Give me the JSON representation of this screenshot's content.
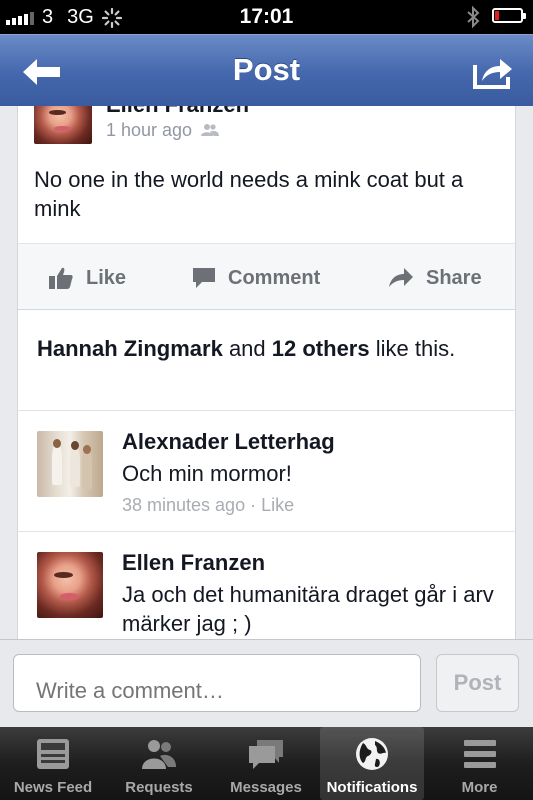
{
  "status_bar": {
    "carrier": "3",
    "network": "3G",
    "time": "17:01"
  },
  "nav": {
    "title": "Post"
  },
  "post": {
    "author": "Ellen Franzen",
    "time": "1 hour ago",
    "text": "No one in the world needs a mink coat but a mink"
  },
  "actions": {
    "like": "Like",
    "comment": "Comment",
    "share": "Share"
  },
  "likes": {
    "name": "Hannah Zingmark",
    "and": "and",
    "others": "12 others",
    "suffix": "like this."
  },
  "comments": [
    {
      "author": "Alexnader Letterhag",
      "text": "Och min mormor!",
      "time": "38 minutes ago",
      "sep": "·",
      "like": "Like"
    },
    {
      "author": "Ellen Franzen",
      "text": "Ja och det humanitära draget går i arv märker jag ; )"
    }
  ],
  "composer": {
    "placeholder": "Write a comment…",
    "post_label": "Post"
  },
  "tabbar": [
    {
      "label": "News Feed",
      "icon": "news-feed-icon"
    },
    {
      "label": "Requests",
      "icon": "requests-icon"
    },
    {
      "label": "Messages",
      "icon": "messages-icon"
    },
    {
      "label": "Notifications",
      "icon": "globe-icon",
      "active": true
    },
    {
      "label": "More",
      "icon": "menu-icon"
    }
  ],
  "colors": {
    "nav_blue": "#4467ad",
    "text": "#141823",
    "muted": "#9197a3",
    "action_gray": "#6d7177",
    "battery_low": "#e02020"
  }
}
